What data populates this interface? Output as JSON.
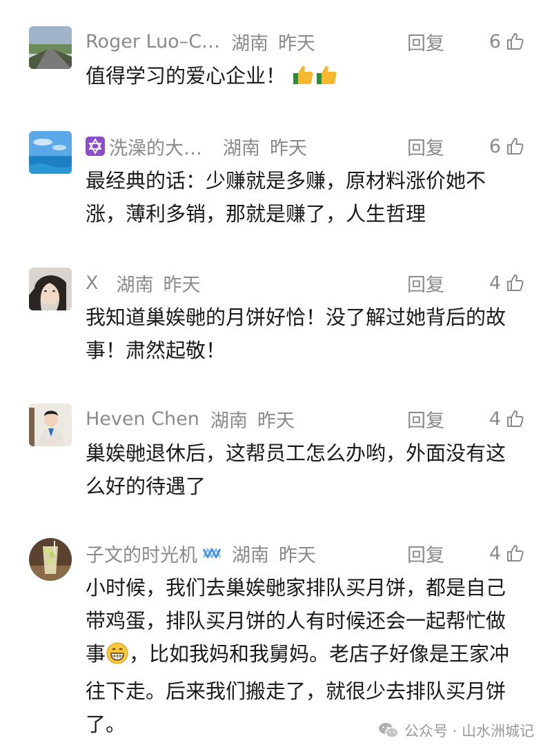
{
  "comments": [
    {
      "name": "Roger Luo–C…",
      "location": "湖南",
      "time": "昨天",
      "reply_label": "回复",
      "likes": "6",
      "text": "值得学习的爱心企业！",
      "avatar_icon": "road-landscape-avatar"
    },
    {
      "name": "洗澡的大…",
      "location": "湖南",
      "time": "昨天",
      "reply_label": "回复",
      "likes": "6",
      "text": "最经典的话：少赚就是多赚，原材料涨价她不涨，薄利多销，那就是赚了，人生哲理",
      "avatar_icon": "sea-sky-avatar",
      "badge_icon": "star-of-david-icon"
    },
    {
      "name": "X",
      "location": "湖南",
      "time": "昨天",
      "reply_label": "回复",
      "likes": "4",
      "text": "我知道巢娭毑的月饼好恰！没了解过她背后的故事！肃然起敬！",
      "avatar_icon": "person-photo-avatar"
    },
    {
      "name": "Heven Chen",
      "location": "湖南",
      "time": "昨天",
      "reply_label": "回复",
      "likes": "4",
      "text": "巢娭毑退休后，这帮员工怎么办哟，外面没有这么好的待遇了",
      "avatar_icon": "portrait-avatar"
    },
    {
      "name": "子文的时光机",
      "location": "湖南",
      "time": "昨天",
      "reply_label": "回复",
      "likes": "4",
      "text_before_emoji": "小时候，我们去巢娭毑家排队买月饼，都是自己带鸡蛋，排队买月饼的人有时候还会一起帮忙做事",
      "text_after_emoji": "，比如我妈和我舅妈。老店子好像是王家冲往下走。后来我们搬走了，就很少去排队买月饼了。",
      "avatar_icon": "drink-glass-avatar",
      "badge_icon": "infinity-icon"
    }
  ],
  "watermark": {
    "label": "公众号 · 山水洲城记",
    "icon": "wechat-icon"
  },
  "colors": {
    "meta_text": "#8a8a8a",
    "body_text": "#1a1a1a",
    "accent_blue": "#3a8ee6",
    "badge_purple": "#8a4fc8"
  }
}
